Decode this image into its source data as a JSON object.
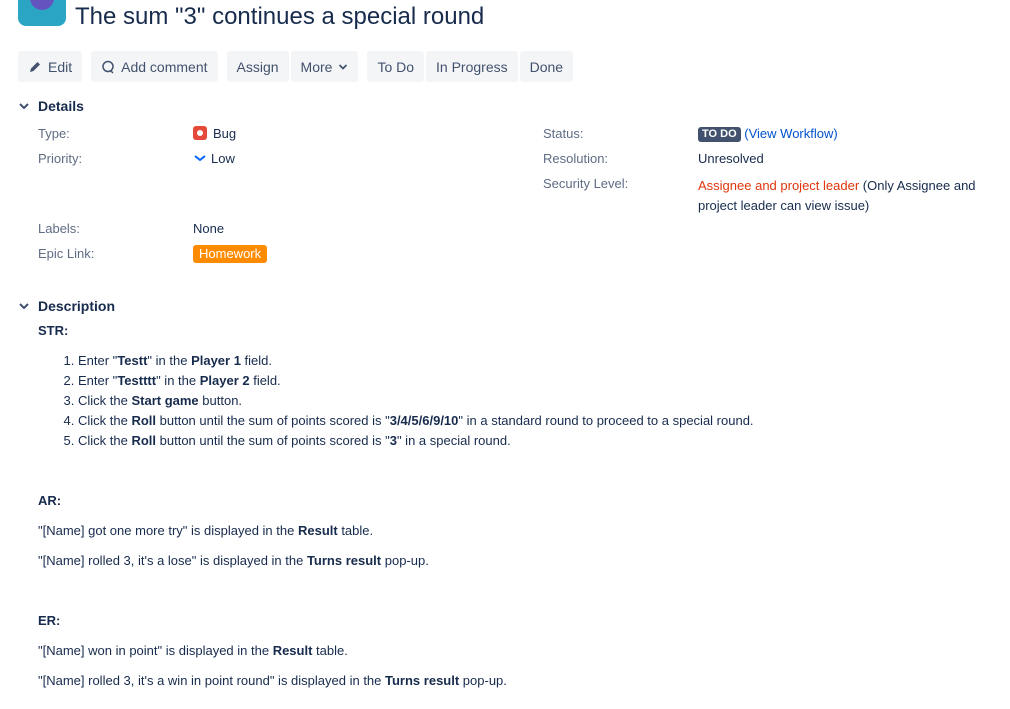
{
  "issue": {
    "title": "The sum \"3\" continues a special round"
  },
  "toolbar": {
    "edit": "Edit",
    "add_comment": "Add comment",
    "assign": "Assign",
    "more": "More",
    "todo": "To Do",
    "in_progress": "In Progress",
    "done": "Done"
  },
  "details": {
    "heading": "Details",
    "type_label": "Type:",
    "type_value": "Bug",
    "priority_label": "Priority:",
    "priority_value": "Low",
    "labels_label": "Labels:",
    "labels_value": "None",
    "epic_label": "Epic Link:",
    "epic_value": "Homework",
    "status_label": "Status:",
    "status_value": "TO DO",
    "view_workflow": "View Workflow",
    "resolution_label": "Resolution:",
    "resolution_value": "Unresolved",
    "security_label": "Security Level:",
    "security_value": "Assignee and project leader",
    "security_note_1": "(Only Assignee and",
    "security_note_2": "project leader can view issue)"
  },
  "description": {
    "heading": "Description",
    "str_heading": "STR:",
    "steps": [
      [
        "Enter \"",
        "Testt",
        "\" in the ",
        "Player 1",
        " field.",
        "",
        ""
      ],
      [
        "Enter \"",
        "Testttt",
        "\" in the ",
        "Player 2",
        " field.",
        "",
        ""
      ],
      [
        "Click the ",
        "Start game",
        " button.",
        "",
        "",
        "",
        ""
      ],
      [
        "Click the ",
        "Roll",
        " button until the sum of points scored is \"",
        "3/4/5/6/9/10",
        "\" in a standard round to proceed to a special round.",
        "",
        ""
      ],
      [
        "Click the ",
        "Roll",
        " button until the sum of points scored is \"",
        "3",
        "\" in a special round.",
        "",
        ""
      ]
    ],
    "ar_heading": "AR:",
    "ar_lines": [
      [
        "\"[Name] got one more try\" is displayed in the ",
        "Result",
        " table."
      ],
      [
        "\"[Name] rolled 3, it's a lose\" is displayed in the ",
        "Turns result",
        " pop-up."
      ]
    ],
    "er_heading": "ER:",
    "er_lines": [
      [
        "\"[Name] won in point\" is displayed in the ",
        "Result",
        " table."
      ],
      [
        "\"[Name] rolled 3, it's a win in point round\" is displayed in the ",
        "Turns result",
        " pop-up."
      ]
    ]
  },
  "colors": {
    "accent": "#0052cc",
    "bug": "#e5493a",
    "epic": "#ff8b00",
    "security": "#de350b",
    "lozenge": "#42526e"
  }
}
